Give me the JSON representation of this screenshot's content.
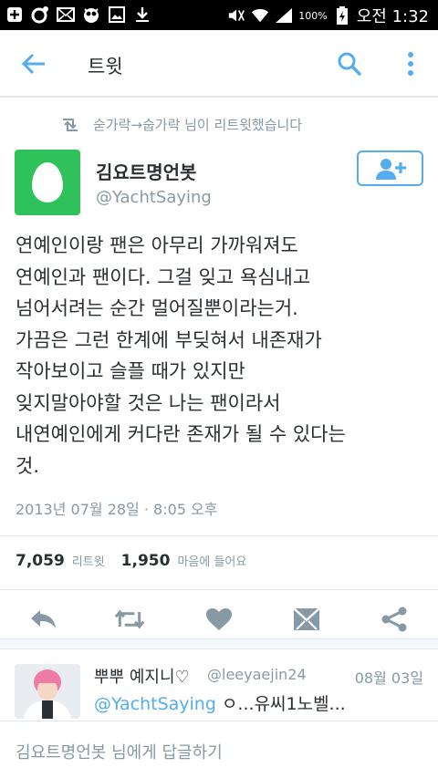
{
  "statusbar": {
    "battery_text": "100%",
    "clock": "오전 1:32",
    "icons": [
      "add-box-icon",
      "chat-ring-icon",
      "mail-icon",
      "owl-icon",
      "image-icon",
      "download-icon",
      "mute-icon",
      "wifi-icon",
      "signal-icon",
      "battery-icon"
    ]
  },
  "appbar": {
    "title": "트윗",
    "icons": [
      "back-arrow-icon",
      "search-icon",
      "more-vertical-icon"
    ]
  },
  "retweet_context": "숟가락→숩가락 님이 리트윗했습니다",
  "tweet": {
    "author_name": "김요트명언봇",
    "author_handle": "@YachtSaying",
    "lines": [
      "연예인이랑 팬은 아무리 가까워져도",
      "연예인과 팬이다. 그걸 잊고 욕심내고",
      "넘어서려는 순간 멀어질뿐이라는거.",
      "가끔은 그런 한계에 부딪혀서 내존재가",
      "작아보이고 슬플 때가 있지만",
      "잊지말아야할 것은 나는 팬이라서",
      "내연예인에게 커다란 존재가 될 수 있다는",
      "것."
    ],
    "timestamp": "2013년 07월 28일 · 8:05 오후",
    "retweets_count": "7,059",
    "retweets_label": "리트윗",
    "likes_count": "1,950",
    "likes_label": "마음에 들어요"
  },
  "actions": [
    "reply-icon",
    "retweet-icon",
    "heart-icon",
    "dm-icon",
    "share-icon"
  ],
  "reply": {
    "name": "뿌뿌 예지니♡",
    "handle": "@leeyaejin24",
    "date": "08월 03일",
    "mention": "@YachtSaying",
    "text": " ㅇ...유씨1노벨..."
  },
  "reply_bar": {
    "placeholder": "김요트명언봇 님에게 답글하기"
  },
  "colors": {
    "accent": "#55acee",
    "muted": "#8899a6",
    "text": "#292f33",
    "egg_bg": "#2fc25b"
  }
}
